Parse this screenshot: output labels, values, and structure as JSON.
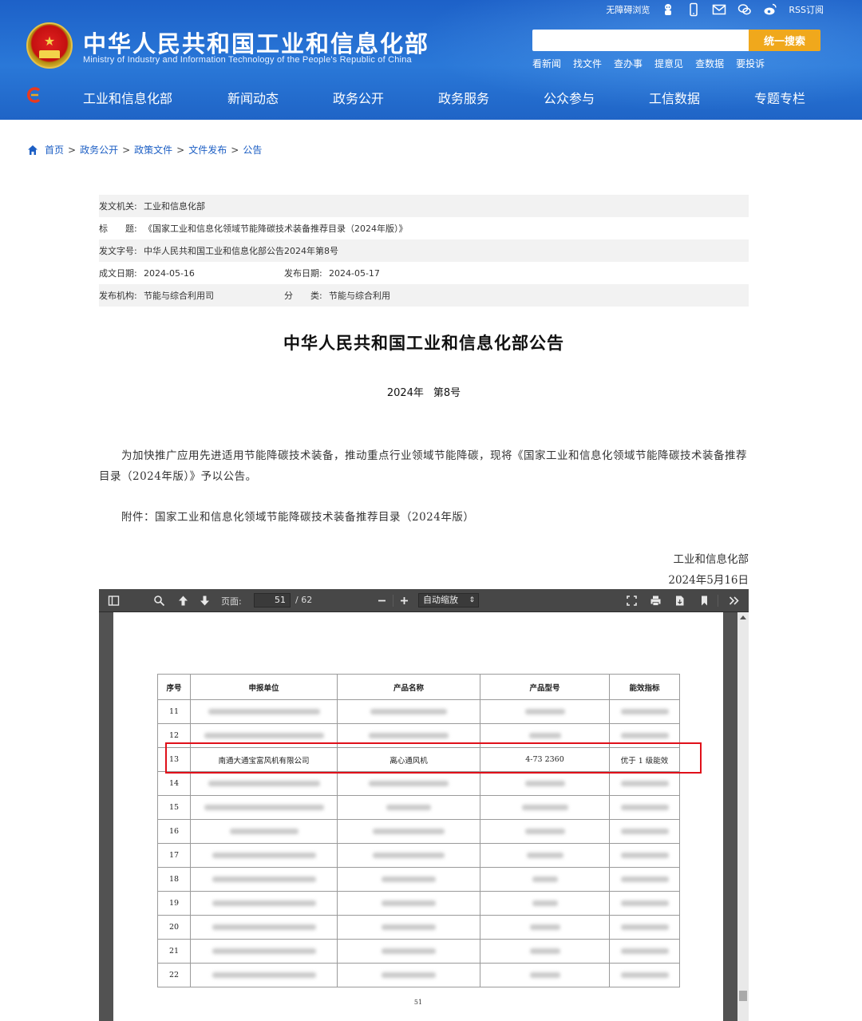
{
  "header": {
    "site_title": "中华人民共和国工业和信息化部",
    "site_subtitle": "Ministry of Industry and Information Technology of the People's Republic of China",
    "accessibility": "无障碍浏览",
    "rss": "RSS订阅",
    "search_button": "统一搜索",
    "search_placeholder": "",
    "quick_links": [
      "看新闻",
      "找文件",
      "查办事",
      "提意见",
      "查数据",
      "要投诉"
    ],
    "nav": [
      "工业和信息化部",
      "新闻动态",
      "政务公开",
      "政务服务",
      "公众参与",
      "工信数据",
      "专题专栏"
    ]
  },
  "breadcrumb": [
    "首页",
    "政务公开",
    "政策文件",
    "文件发布",
    "公告"
  ],
  "meta": {
    "issuer_label": "发文机关:",
    "issuer": "工业和信息化部",
    "title_label": "标　　题:",
    "title": "《国家工业和信息化领域节能降碳技术装备推荐目录（2024年版）》",
    "docno_label": "发文字号:",
    "docno": "中华人民共和国工业和信息化部公告2024年第8号",
    "created_label": "成文日期:",
    "created": "2024-05-16",
    "published_label": "发布日期:",
    "published": "2024-05-17",
    "org_label": "发布机构:",
    "org": "节能与综合利用司",
    "category_label": "分　　类:",
    "category": "节能与综合利用"
  },
  "document": {
    "title": "中华人民共和国工业和信息化部公告",
    "year": "2024年",
    "number": "第8号",
    "paragraph": "为加快推广应用先进适用节能降碳技术装备，推动重点行业领域节能降碳，现将《国家工业和信息化领域节能降碳技术装备推荐目录（2024年版）》予以公告。",
    "attachment": "附件：国家工业和信息化领域节能降碳技术装备推荐目录（2024年版）",
    "signer": "工业和信息化部",
    "sign_date": "2024年5月16日"
  },
  "pdf": {
    "page_label": "页面:",
    "current_page": "51",
    "total_pages": "/ 62",
    "zoom": "自动缩放",
    "page_number_footer": "51",
    "table_headers": [
      "序号",
      "申报单位",
      "产品名称",
      "产品型号",
      "能效指标"
    ],
    "rows": [
      {
        "no": "11",
        "visible": false
      },
      {
        "no": "12",
        "visible": false
      },
      {
        "no": "13",
        "visible": true,
        "company": "南通大通宝富风机有限公司",
        "product": "离心通风机",
        "model": "4-73 2360",
        "efficiency": "优于 1 级能效"
      },
      {
        "no": "14",
        "visible": false
      },
      {
        "no": "15",
        "visible": false
      },
      {
        "no": "16",
        "visible": false
      },
      {
        "no": "17",
        "visible": false
      },
      {
        "no": "18",
        "visible": false
      },
      {
        "no": "19",
        "visible": false
      },
      {
        "no": "20",
        "visible": false
      },
      {
        "no": "21",
        "visible": false
      },
      {
        "no": "22",
        "visible": false
      }
    ]
  },
  "colors": {
    "header_blue": "#2a78d8",
    "search_button": "#f0a81c",
    "highlight_red": "#e0101a",
    "link_blue": "#1d5fc4"
  }
}
